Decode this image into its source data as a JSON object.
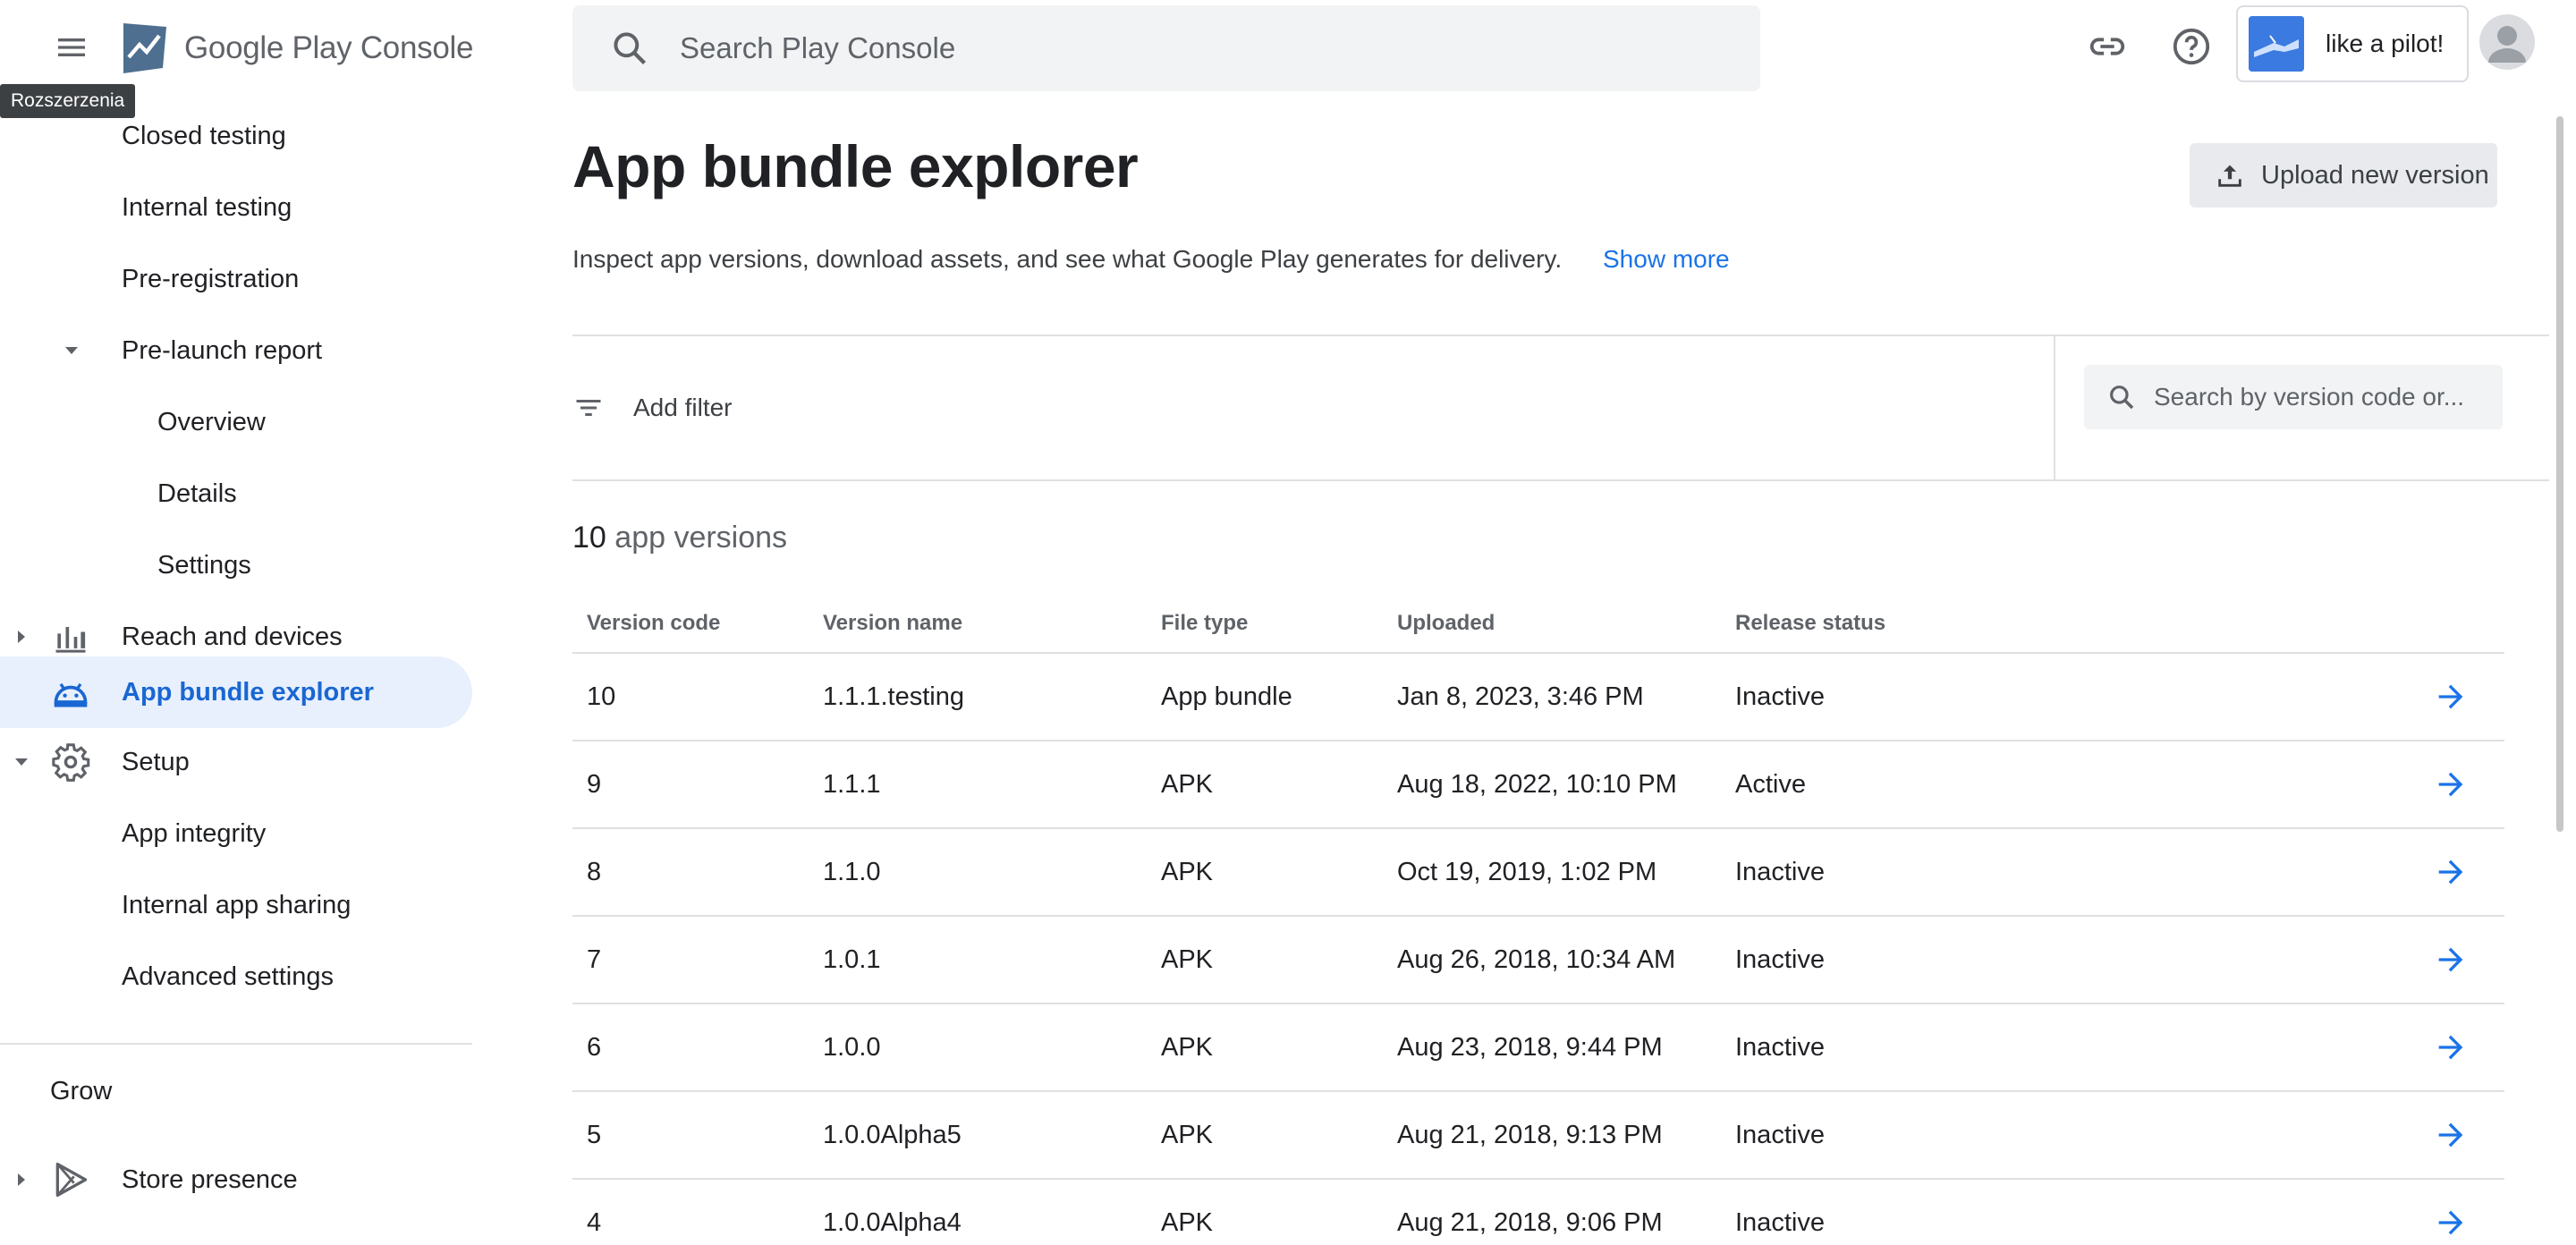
{
  "header": {
    "menu_tooltip": "Rozszerzenia",
    "logo_text_google": "Google Play",
    "logo_text_console": "Console",
    "search_placeholder": "Search Play Console",
    "app_name": "like a pilot!",
    "icons": [
      "menu-icon",
      "play-console-logo",
      "search-icon",
      "link-icon",
      "help-icon",
      "app-icon",
      "account-avatar"
    ]
  },
  "sidebar": {
    "items": [
      {
        "label": "Closed testing",
        "level": 1
      },
      {
        "label": "Internal testing",
        "level": 1
      },
      {
        "label": "Pre-registration",
        "level": 1
      },
      {
        "label": "Pre-launch report",
        "level": 1,
        "expanded": true
      },
      {
        "label": "Overview",
        "level": 2
      },
      {
        "label": "Details",
        "level": 2
      },
      {
        "label": "Settings",
        "level": 2
      },
      {
        "label": "Reach and devices",
        "level": 0,
        "icon": "bar-chart-icon"
      },
      {
        "label": "App bundle explorer",
        "level": 0,
        "icon": "android-icon",
        "active": true
      },
      {
        "label": "Setup",
        "level": 0,
        "icon": "gear-icon",
        "expanded": true
      },
      {
        "label": "App integrity",
        "level": 1
      },
      {
        "label": "Internal app sharing",
        "level": 1
      },
      {
        "label": "Advanced settings",
        "level": 1
      }
    ],
    "section_grow": "Grow",
    "grow_items": [
      {
        "label": "Store presence",
        "icon": "play-icon"
      }
    ]
  },
  "main": {
    "title": "App bundle explorer",
    "upload_label": "Upload new version",
    "description": "Inspect app versions, download assets, and see what Google Play generates for delivery.",
    "show_more": "Show more",
    "add_filter": "Add filter",
    "version_search_placeholder": "Search by version code or...",
    "count_number": "10",
    "count_label": "app versions",
    "columns": [
      "Version code",
      "Version name",
      "File type",
      "Uploaded",
      "Release status"
    ],
    "rows": [
      [
        "10",
        "1.1.1.testing",
        "App bundle",
        "Jan 8, 2023, 3:46 PM",
        "Inactive"
      ],
      [
        "9",
        "1.1.1",
        "APK",
        "Aug 18, 2022, 10:10 PM",
        "Active"
      ],
      [
        "8",
        "1.1.0",
        "APK",
        "Oct 19, 2019, 1:02 PM",
        "Inactive"
      ],
      [
        "7",
        "1.0.1",
        "APK",
        "Aug 26, 2018, 10:34 AM",
        "Inactive"
      ],
      [
        "6",
        "1.0.0",
        "APK",
        "Aug 23, 2018, 9:44 PM",
        "Inactive"
      ],
      [
        "5",
        "1.0.0Alpha5",
        "APK",
        "Aug 21, 2018, 9:13 PM",
        "Inactive"
      ],
      [
        "4",
        "1.0.0Alpha4",
        "APK",
        "Aug 21, 2018, 9:06 PM",
        "Inactive"
      ]
    ]
  },
  "colors": {
    "accent": "#1a73e8",
    "active_bg": "#e8f0fe",
    "active_text": "#1967d2",
    "search_bg": "#f1f3f4",
    "divider": "#e0e0e0"
  }
}
